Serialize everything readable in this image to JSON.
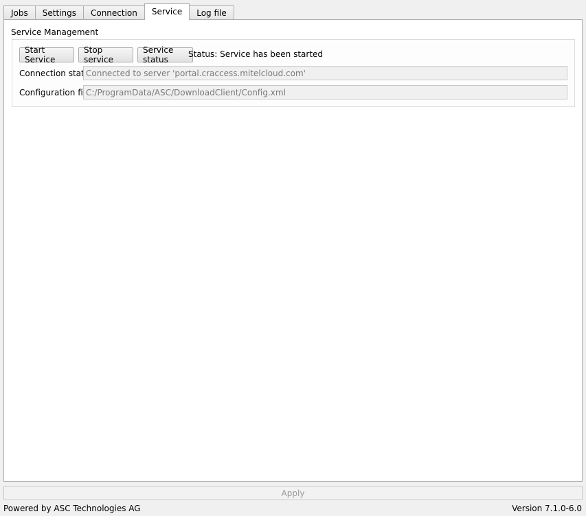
{
  "tabs": [
    {
      "label": "Jobs"
    },
    {
      "label": "Settings"
    },
    {
      "label": "Connection"
    },
    {
      "label": "Service"
    },
    {
      "label": "Log file"
    }
  ],
  "active_tab": "Service",
  "service": {
    "group_title": "Service Management",
    "start_label": "Start Service",
    "stop_label": "Stop service",
    "status_button_label": "Service status",
    "status_text": "Status: Service has been started",
    "connection_status_label": "Connection status",
    "connection_status_value": "Connected to server 'portal.craccess.mitelcloud.com'",
    "config_file_label": "Configuration file",
    "config_file_value": "C:/ProgramData/ASC/DownloadClient/Config.xml"
  },
  "apply_label": "Apply",
  "footer": {
    "powered_by": "Powered by ASC Technologies AG",
    "version": "Version 7.1.0-6.0"
  }
}
